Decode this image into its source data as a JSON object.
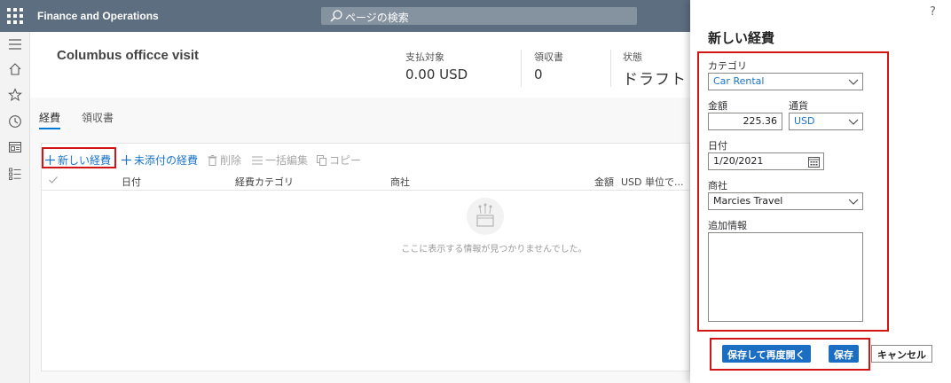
{
  "app": {
    "title": "Finance and Operations"
  },
  "search": {
    "placeholder": "ページの検索"
  },
  "header": {
    "title": "Columbus officce visit",
    "kpis": [
      {
        "label": "支払対象",
        "value": "0.00 USD"
      },
      {
        "label": "領収書",
        "value": "0"
      },
      {
        "label": "状態",
        "value": "ドラフト"
      }
    ]
  },
  "tabs": [
    {
      "label": "経費"
    },
    {
      "label": "領収書"
    }
  ],
  "toolbar": {
    "new_expense": "新しい経費",
    "unattached": "未添付の経費",
    "delete": "削除",
    "bulk_edit": "一括編集",
    "copy": "コピー"
  },
  "grid": {
    "columns": [
      "日付",
      "経費カテゴリ",
      "商社",
      "金額",
      "USD 単位で..."
    ],
    "empty_message": "ここに表示する情報が見つかりませんでした。"
  },
  "panel": {
    "help": "?",
    "title": "新しい経費",
    "category_label": "カテゴリ",
    "category_value": "Car Rental",
    "amount_label": "金額",
    "amount_value": "225.36",
    "currency_label": "通貨",
    "currency_value": "USD",
    "date_label": "日付",
    "date_value": "1/20/2021",
    "merchant_label": "商社",
    "merchant_value": "Marcies Travel",
    "notes_label": "追加情報",
    "notes_value": "",
    "save_reopen": "保存して再度開く",
    "save": "保存",
    "cancel": "キャンセル"
  },
  "colors": {
    "topbar": "#5d6e81",
    "accent": "#1b6ec2",
    "highlight": "#d21414"
  }
}
